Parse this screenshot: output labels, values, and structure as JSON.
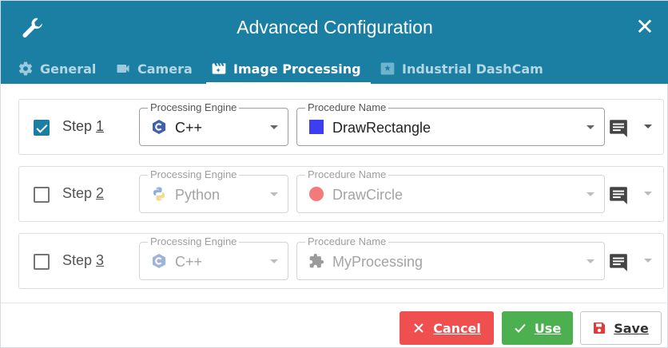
{
  "dialog": {
    "title": "Advanced Configuration",
    "close_label": "✕"
  },
  "tabs": [
    {
      "label": "General",
      "icon": "gear-icon"
    },
    {
      "label": "Camera",
      "icon": "video-camera-icon"
    },
    {
      "label": "Image Processing",
      "icon": "clapperboard-icon",
      "active": true
    },
    {
      "label": "Industrial DashCam",
      "icon": "dashcam-icon"
    }
  ],
  "steps": [
    {
      "prefix": "Step ",
      "number": "1",
      "checked": true,
      "engine_legend": "Processing Engine",
      "engine": "C++",
      "engine_icon": "cpp-icon",
      "procedure_legend": "Procedure Name",
      "procedure": "DrawRectangle",
      "procedure_icon": "blue-square-icon"
    },
    {
      "prefix": "Step ",
      "number": "2",
      "checked": false,
      "engine_legend": "Processing Engine",
      "engine": "Python",
      "engine_icon": "python-icon",
      "procedure_legend": "Procedure Name",
      "procedure": "DrawCircle",
      "procedure_icon": "red-circle-icon"
    },
    {
      "prefix": "Step ",
      "number": "3",
      "checked": false,
      "engine_legend": "Processing Engine",
      "engine": "C++",
      "engine_icon": "cpp-icon",
      "procedure_legend": "Procedure Name",
      "procedure": "MyProcessing",
      "procedure_icon": "puzzle-icon"
    }
  ],
  "footer": {
    "cancel_label": "Cancel",
    "use_label": "Use",
    "save_label": "Save"
  },
  "colors": {
    "header": "#1b7fa3",
    "cancel": "#ef4f4f",
    "use": "#4caf50",
    "rectangle": "#3d3df2",
    "circle": "#f27a7a"
  }
}
